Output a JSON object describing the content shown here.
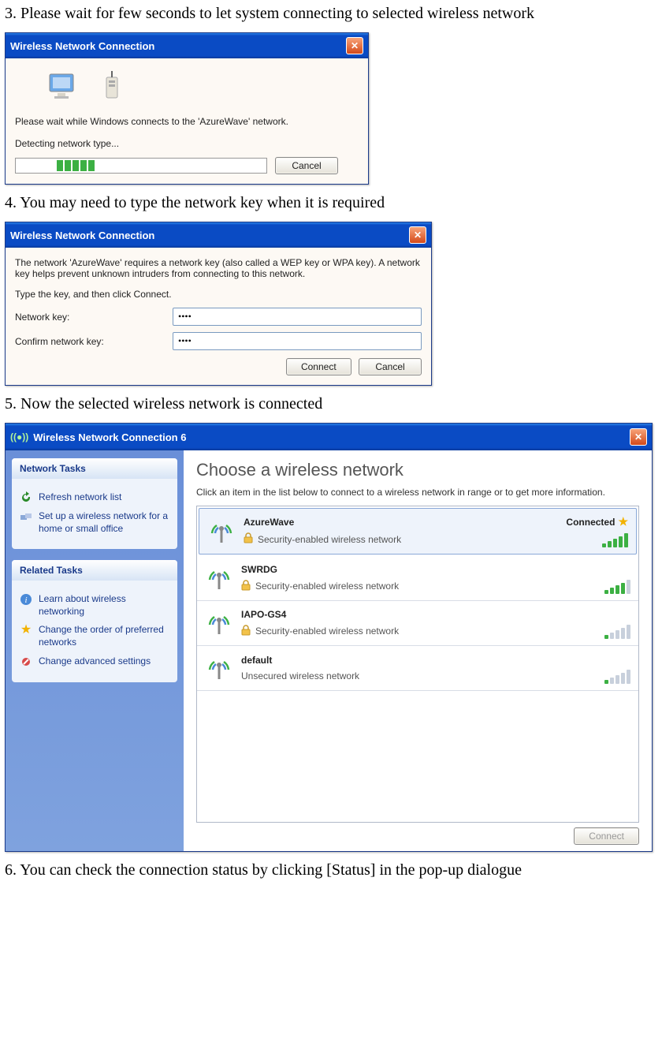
{
  "steps": {
    "s3": "3. Please wait for few seconds to let system connecting to selected wireless network",
    "s4": "4. You may need to type the network key when it is required",
    "s5": "5. Now the selected wireless network is connected",
    "s6": "6. You can check the connection status by clicking [Status] in the pop-up dialogue"
  },
  "dialog1": {
    "title": "Wireless Network Connection",
    "msg": "Please wait while Windows connects to the 'AzureWave' network.",
    "status": "Detecting network type...",
    "cancel": "Cancel"
  },
  "dialog2": {
    "title": "Wireless Network Connection",
    "msg": "The network 'AzureWave' requires a network key (also called a WEP key or WPA key). A network key helps prevent unknown intruders from connecting to this network.",
    "prompt": "Type the key, and then click Connect.",
    "key_label": "Network key:",
    "confirm_label": "Confirm network key:",
    "key_value": "••••",
    "confirm_value": "••••",
    "connect": "Connect",
    "cancel": "Cancel"
  },
  "dialog3": {
    "title": "Wireless Network Connection 6",
    "sidebar": {
      "tasks_header": "Network Tasks",
      "refresh": "Refresh network list",
      "setup": "Set up a wireless network for a home or small office",
      "related_header": "Related Tasks",
      "learn": "Learn about wireless networking",
      "order": "Change the order of preferred networks",
      "advanced": "Change advanced settings"
    },
    "main": {
      "heading": "Choose a wireless network",
      "sub": "Click an item in the list below to connect to a wireless network in range or to get more information.",
      "connected": "Connected",
      "connect_btn": "Connect",
      "secure": "Security-enabled wireless network",
      "unsecure": "Unsecured wireless network",
      "networks": [
        {
          "name": "AzureWave",
          "secure": true,
          "signal": 5,
          "connected": true
        },
        {
          "name": "SWRDG",
          "secure": true,
          "signal": 4,
          "connected": false
        },
        {
          "name": "IAPO-GS4",
          "secure": true,
          "signal": 1,
          "connected": false
        },
        {
          "name": "default",
          "secure": false,
          "signal": 1,
          "connected": false
        }
      ]
    }
  }
}
